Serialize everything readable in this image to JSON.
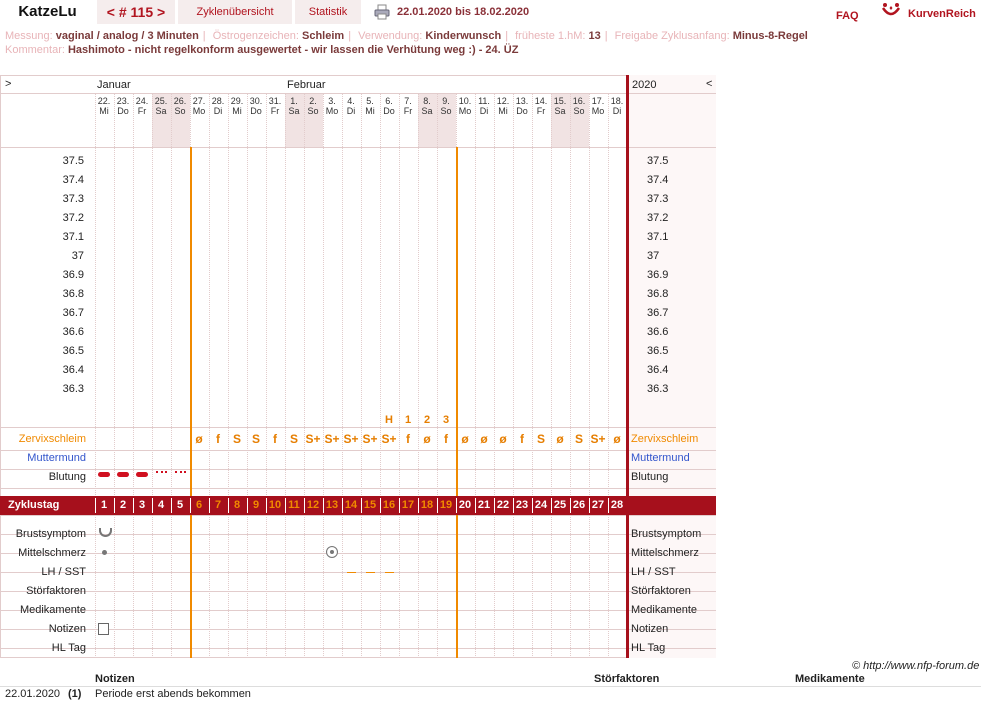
{
  "header": {
    "app_title": "KatzeLu",
    "cycle_nav": "< # 115 >",
    "overview_button": "Zyklenübersicht",
    "stats_button": "Statistik",
    "date_range": "22.01.2020 bis 18.02.2020",
    "faq": "FAQ",
    "logo_text": "KurvenReich"
  },
  "info": {
    "messung_label": "Messung:",
    "messung_value": "vaginal / analog / 3 Minuten",
    "oestrogen_label": "Östrogenzeichen:",
    "oestrogen_value": "Schleim",
    "verwendung_label": "Verwendung:",
    "verwendung_value": "Kinderwunsch",
    "fhm_label": "früheste 1.hM:",
    "fhm_value": "13",
    "freigabe_label": "Freigabe Zyklusanfang:",
    "freigabe_value": "Minus-8-Regel",
    "kommentar_label": "Kommentar:",
    "kommentar_value": "Hashimoto - nicht regelkonform ausgewertet  - wir lassen die Verhütung weg :) - 24. ÜZ"
  },
  "chart": {
    "nav_left": ">",
    "nav_right": "<",
    "year": "2020",
    "months": [
      "Januar",
      "Februar"
    ],
    "days": [
      {
        "d": "22.",
        "w": "Mi",
        "we": false
      },
      {
        "d": "23.",
        "w": "Do",
        "we": false
      },
      {
        "d": "24.",
        "w": "Fr",
        "we": false
      },
      {
        "d": "25.",
        "w": "Sa",
        "we": true
      },
      {
        "d": "26.",
        "w": "So",
        "we": true
      },
      {
        "d": "27.",
        "w": "Mo",
        "we": false
      },
      {
        "d": "28.",
        "w": "Di",
        "we": false
      },
      {
        "d": "29.",
        "w": "Mi",
        "we": false
      },
      {
        "d": "30.",
        "w": "Do",
        "we": false
      },
      {
        "d": "31.",
        "w": "Fr",
        "we": false
      },
      {
        "d": "1.",
        "w": "Sa",
        "we": true
      },
      {
        "d": "2.",
        "w": "So",
        "we": true
      },
      {
        "d": "3.",
        "w": "Mo",
        "we": false
      },
      {
        "d": "4.",
        "w": "Di",
        "we": false
      },
      {
        "d": "5.",
        "w": "Mi",
        "we": false
      },
      {
        "d": "6.",
        "w": "Do",
        "we": false
      },
      {
        "d": "7.",
        "w": "Fr",
        "we": false
      },
      {
        "d": "8.",
        "w": "Sa",
        "we": true
      },
      {
        "d": "9.",
        "w": "So",
        "we": true
      },
      {
        "d": "10.",
        "w": "Mo",
        "we": false
      },
      {
        "d": "11.",
        "w": "Di",
        "we": false
      },
      {
        "d": "12.",
        "w": "Mi",
        "we": false
      },
      {
        "d": "13.",
        "w": "Do",
        "we": false
      },
      {
        "d": "14.",
        "w": "Fr",
        "we": false
      },
      {
        "d": "15.",
        "w": "Sa",
        "we": true
      },
      {
        "d": "16.",
        "w": "So",
        "we": true
      },
      {
        "d": "17.",
        "w": "Mo",
        "we": false
      },
      {
        "d": "18.",
        "w": "Di",
        "we": false
      }
    ],
    "temp_ticks": [
      "37.5",
      "37.4",
      "37.3",
      "37.2",
      "37.1",
      "37",
      "36.9",
      "36.8",
      "36.7",
      "36.6",
      "36.5",
      "36.4",
      "36.3"
    ],
    "peak_labels": [
      "H",
      "1",
      "2",
      "3"
    ],
    "cervix_row_label": "Zervixschleim",
    "cervix": [
      "",
      "",
      "",
      "",
      "",
      "ø",
      "f",
      "S",
      "S",
      "f",
      "S",
      "S+",
      "S+",
      "S+",
      "S+",
      "S+",
      "f",
      "ø",
      "f",
      "ø",
      "ø",
      "ø",
      "f",
      "S",
      "ø",
      "S",
      "S+",
      "ø"
    ],
    "muttermund_label": "Muttermund",
    "blutung_label": "Blutung",
    "zyklustag_label": "Zyklustag",
    "cycle_days": [
      "1",
      "2",
      "3",
      "4",
      "5",
      "6",
      "7",
      "8",
      "9",
      "10",
      "11",
      "12",
      "13",
      "14",
      "15",
      "16",
      "17",
      "18",
      "19",
      "20",
      "21",
      "22",
      "23",
      "24",
      "25",
      "26",
      "27",
      "28"
    ],
    "brustsymptom_label": "Brustsymptom",
    "mittelschmerz_label": "Mittelschmerz",
    "lhsst_label": "LH / SST",
    "stoerfaktoren_label": "Störfaktoren",
    "medikamente_label": "Medikamente",
    "notizen_label": "Notizen",
    "hltag_label": "HL Tag",
    "colors": {
      "accent": "#a6101c",
      "orange": "#f08a00",
      "blue": "#3355cc",
      "grid": "#e2cccc",
      "weekend": "#f1e3e3"
    }
  },
  "footer": {
    "copyright": "© http://www.nfp-forum.de",
    "notes_header": "Notizen",
    "stoer_header": "Störfaktoren",
    "medi_header": "Medikamente",
    "note_date": "22.01.2020",
    "note_num": "(1)",
    "note_text": "Periode erst abends bekommen"
  }
}
